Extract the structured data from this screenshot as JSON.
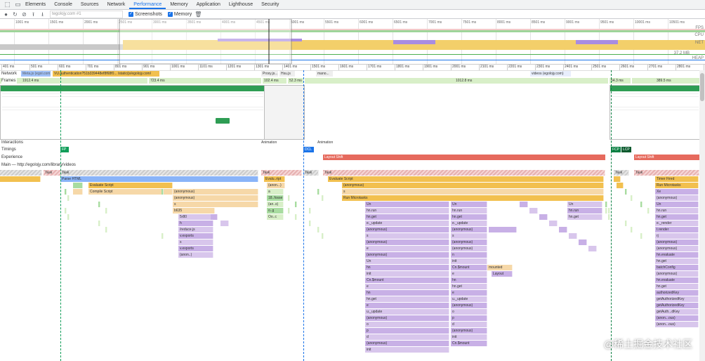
{
  "devtools": {
    "tabs": [
      "Elements",
      "Console",
      "Sources",
      "Network",
      "Performance",
      "Memory",
      "Application",
      "Lighthouse",
      "Security"
    ],
    "active_tab": "Performance"
  },
  "toolbar": {
    "url_select": "tegolojy.com #1",
    "screenshots_label": "Screenshots",
    "memory_label": "Memory"
  },
  "overview": {
    "ticks": [
      "1001 ms",
      "1501 ms",
      "2001 ms",
      "2501 ms",
      "3001 ms",
      "3501 ms",
      "4001 ms",
      "4501 ms",
      "5001 ms",
      "5501 ms",
      "6001 ms",
      "6501 ms",
      "7001 ms",
      "7501 ms",
      "8001 ms",
      "8501 ms",
      "9001 ms",
      "9501 ms",
      "10001 ms",
      "10501 ms"
    ],
    "fps_label": "FPS",
    "cpu_label": "CPU",
    "net_label": "NET",
    "heap_label": "HEAP",
    "heap_value": "37.2 MB"
  },
  "ruler": {
    "ticks": [
      "401 ms",
      "501 ms",
      "601 ms",
      "701 ms",
      "801 ms",
      "901 ms",
      "1001 ms",
      "1101 ms",
      "1201 ms",
      "1301 ms",
      "1401 ms",
      "1501 ms",
      "1601 ms",
      "1701 ms",
      "1801 ms",
      "1901 ms",
      "2001 ms",
      "2101 ms",
      "2201 ms",
      "2301 ms",
      "2401 ms",
      "2501 ms",
      "2601 ms",
      "2701 ms",
      "2801 ms",
      "2901 ms"
    ]
  },
  "tracks": {
    "network_label": "Network",
    "network_items": [
      "Meta.js (egol.com)",
      "VU.authentication?51b339448ef8f68f0... /static/js/egolojy.com/",
      "Proxy.js...",
      "Hsu.js",
      "mano...",
      "videos (egolojy.com)"
    ],
    "frames_label": "Frames",
    "frames": [
      "1912.4 ms",
      "723.4 ms",
      "102.4 ms",
      "52.3 ms",
      "1012.8 ms",
      "54.3 ms",
      "389.5 ms"
    ],
    "interactions_label": "Interactions",
    "interactions": [
      "Animation",
      "Animation"
    ],
    "timings_label": "Timings",
    "timings": [
      "FP",
      "DCL",
      "FCP",
      "LCP"
    ],
    "experience_label": "Experience",
    "experience": [
      "Layout Shift",
      "Layout Shift"
    ],
    "main_label": "Main — http://egolojy.com/library/videos"
  },
  "flame": {
    "task_label": "Task",
    "rows": [
      {
        "col": "a",
        "items": [
          "Parse HTML",
          "Evaluate Script",
          "Compile Script",
          "(anonymous)",
          "(anonymous)",
          "s",
          "b635",
          "5r80",
          "h",
          "/reduce.js",
          "v.exports",
          "s",
          "v.exports",
          "(anon..)"
        ]
      },
      {
        "col": "b",
        "items": [
          "Evalu..ript",
          "(anon...)",
          "a",
          "18..fosse",
          "(an..s)",
          "o..g",
          "Oo..c"
        ]
      },
      {
        "col": "c",
        "items": [
          "Evaluate Script",
          "(anonymous)",
          "s",
          "Run Microtasks",
          "Un",
          "hn.run",
          "hn.get",
          "e._update",
          "(anonymous)",
          "s",
          "(anonymous)",
          "e",
          "(anonymous)",
          "Un",
          "hn",
          "init",
          "Cn.$mount",
          "e",
          "hn",
          "hn.get",
          "e",
          "u._update",
          "(anonymous)",
          "o",
          "p",
          "d",
          "(anonymous)",
          "init",
          "Cn.$mount"
        ]
      },
      {
        "col": "d",
        "items": [
          "Un",
          "hn.run",
          "hn.get",
          "e._update",
          "(anonymous)",
          "s",
          "(anonymous)",
          "(anonymous)",
          "n",
          "init",
          "Cn.$mount",
          "e",
          "hn",
          "hn.get",
          "e",
          "u._update",
          "(anonymous)",
          "o",
          "p",
          "d",
          "(anonymous)",
          "init",
          "Cn.$mount"
        ]
      },
      {
        "col": "e",
        "items": [
          "mounted",
          "Layout"
        ]
      },
      {
        "col": "f",
        "items": [
          "Timer Fired",
          "Run Microtasks",
          "Xe",
          "(anonymous)",
          "Un",
          "hn.run",
          "hn.get",
          "e._render",
          "t.render",
          "rj",
          "(anonymous)",
          "(anonymous)",
          "hn.evaluate",
          "hn.get",
          "batchConfig",
          "(anonymous)",
          "hn.evaluate",
          "hn.get",
          "authorizedKey",
          "getAuthorizedKey",
          "getAuthorizedKey",
          "getAuth...dKey",
          "(anon...ous)",
          "(anon...ous)"
        ]
      }
    ]
  },
  "watermark": "@稀土掘金技术社区"
}
